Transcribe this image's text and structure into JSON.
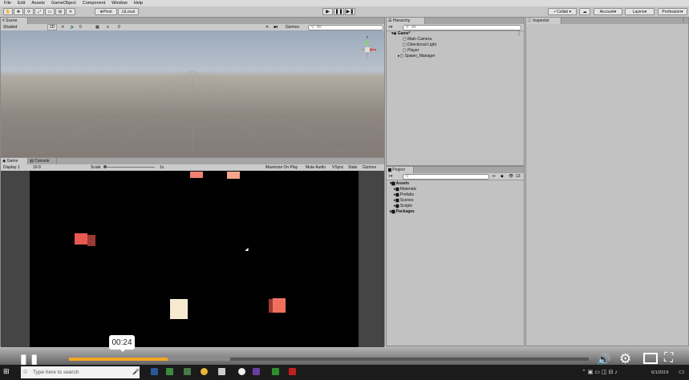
{
  "menu": [
    "File",
    "Edit",
    "Assets",
    "GameObject",
    "Component",
    "Window",
    "Help"
  ],
  "toolbar": {
    "pivot": "Pivot",
    "local": "Local",
    "collab": "Collab ▾",
    "account": "Account",
    "layers": "Layers",
    "layout": "Profession"
  },
  "scene": {
    "tab": "Scene",
    "shading": "Shaded",
    "mode_2d": "2D",
    "counter_a": "0",
    "counter_b": "0",
    "gizmos": "Gizmos",
    "search_placeholder": "All",
    "gizmo_axis_y": "y",
    "gizmo_axis_x": "x"
  },
  "game": {
    "tab_game": "Game",
    "tab_console": "Console",
    "display": "Display 1",
    "aspect": "16:9",
    "scale_label": "Scale",
    "scale_value": "1x",
    "maximize": "Maximize On Play",
    "mute": "Mute Audio",
    "vsync": "VSync",
    "stats": "Stats",
    "gizmos": "Gizmos"
  },
  "hierarchy": {
    "tab": "Hierarchy",
    "search_placeholder": "All",
    "scene_name": "Game*",
    "items": [
      "Main Camera",
      "Directional Light",
      "Player",
      "Spawn_Manager"
    ]
  },
  "project": {
    "tab": "Project",
    "count": "13",
    "assets": "Assets",
    "folders": [
      "Materials",
      "Prefabs",
      "Scenes",
      "Scripts"
    ],
    "packages": "Packages"
  },
  "inspector": {
    "tab": "Inspector"
  },
  "video": {
    "time": "00:24",
    "progress": 0.19,
    "buffered": 0.31
  },
  "taskbar": {
    "search_placeholder": "Type here to search",
    "date": "6/1/2019"
  }
}
